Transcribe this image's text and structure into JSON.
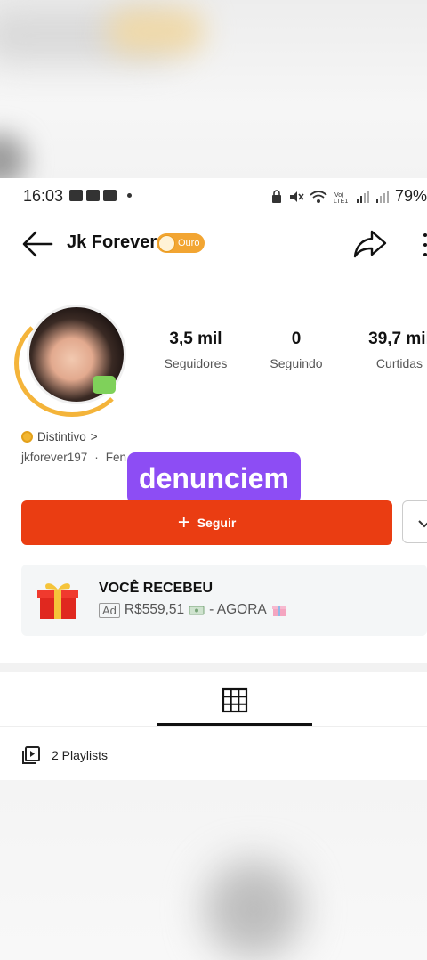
{
  "status_bar": {
    "time": "16:03",
    "battery": "79%"
  },
  "profile": {
    "name": "Jk Forever",
    "tier_badge": "Ouro",
    "handle": "jkforever197",
    "handle_extra": "Fen"
  },
  "stats": [
    {
      "value": "3,5 mil",
      "label": "Seguidores"
    },
    {
      "value": "0",
      "label": "Seguindo"
    },
    {
      "value": "39,7 mil",
      "label": "Curtidas"
    }
  ],
  "distintivo": {
    "label": "Distintivo",
    "chevron": ">"
  },
  "overlay_text": "denunciem",
  "follow_button": {
    "label": "Seguir",
    "icon": "plus-icon"
  },
  "gift_banner": {
    "title": "VOCÊ RECEBEU",
    "ad_tag": "Ad",
    "amount": "R$559,51",
    "suffix": "- AGORA"
  },
  "playlists": {
    "label": "2 Playlists"
  },
  "colors": {
    "accent": "#ea3d12",
    "overlay": "#8d4df4",
    "gold": "#f2a532"
  }
}
